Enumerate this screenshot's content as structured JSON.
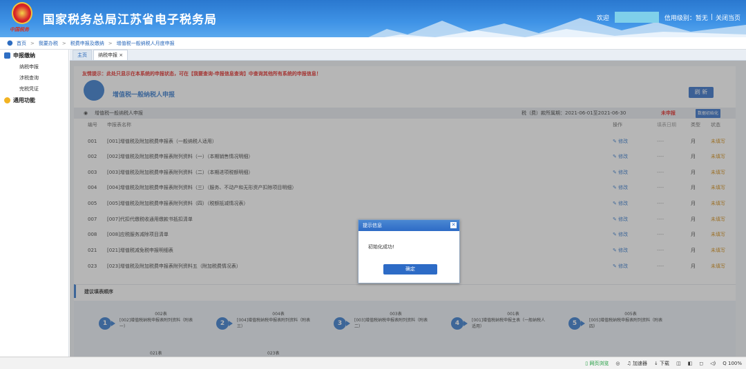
{
  "header": {
    "title": "国家税务总局江苏省电子税务局",
    "emblem_subtitle": "中国税务",
    "welcome": "欢迎",
    "credit": "信用级别：暂无",
    "divider": "|",
    "close_link": "关闭当页"
  },
  "breadcrumb": [
    "首页",
    "我要办税",
    "税费申报及缴纳",
    "增值税一般纳税人月度申报"
  ],
  "breadcrumb_sep": ">",
  "sidebar": {
    "group1": "申报缴纳",
    "items": [
      "纳税申报",
      "涉税查询",
      "完税凭证"
    ],
    "group2": "通用功能"
  },
  "tabs": [
    {
      "label": "主页"
    },
    {
      "label": "纳税申报 ×"
    }
  ],
  "content": {
    "notice": "友情提示：此处只显示在本系统的申报状态，可在【我要查询-申报信息查询】中查询其他所有系统的申报信息！",
    "biz_title": "增值税一般纳税人申报",
    "refresh": "刷 新",
    "section_radio": "◉",
    "section_title": "增值税一般纳税人申报",
    "period": "税（费）款所属期：2021-06-01至2021-06-30",
    "status": "未申报",
    "init_button": "数据初始化",
    "columns": [
      "编号",
      "申报表名称",
      "操作",
      "填表日期",
      "类型",
      "状态"
    ],
    "rows": [
      {
        "num": "001",
        "name": "[001]增值税及附加税费申报表（一般纳税人适用）",
        "op": "✎ 修改",
        "date": "----",
        "type": "月",
        "status": "未填写"
      },
      {
        "num": "002",
        "name": "[002]增值税及附加税费申报表附列资料（一）（本期销售情况明细）",
        "op": "✎ 修改",
        "date": "----",
        "type": "月",
        "status": "未填写"
      },
      {
        "num": "003",
        "name": "[003]增值税及附加税费申报表附列资料（二）（本期进项税额明细）",
        "op": "✎ 修改",
        "date": "----",
        "type": "月",
        "status": "未填写"
      },
      {
        "num": "004",
        "name": "[004]增值税及附加税费申报表附列资料（三）（服务、不动产和无形资产扣除项目明细）",
        "op": "✎ 修改",
        "date": "----",
        "type": "月",
        "status": "未填写"
      },
      {
        "num": "005",
        "name": "[005]增值税及附加税费申报表附列资料（四）（税额抵减情况表）",
        "op": "✎ 修改",
        "date": "----",
        "type": "月",
        "status": "未填写"
      },
      {
        "num": "007",
        "name": "[007]代扣代缴税收通用缴款书抵扣清单",
        "op": "✎ 修改",
        "date": "----",
        "type": "月",
        "status": "未填写"
      },
      {
        "num": "008",
        "name": "[008]应税服务减除项目清单",
        "op": "✎ 修改",
        "date": "----",
        "type": "月",
        "status": "未填写"
      },
      {
        "num": "021",
        "name": "[021]增值税减免税申报明细表",
        "op": "✎ 修改",
        "date": "----",
        "type": "月",
        "status": "未填写"
      },
      {
        "num": "023",
        "name": "[023]增值税及附加税费申报表附列资料五（附加税费情况表）",
        "op": "✎ 修改",
        "date": "----",
        "type": "月",
        "status": "未填写"
      }
    ],
    "suggest_title": "建议填表顺序",
    "steps": [
      {
        "n": "1",
        "code": "002表",
        "desc": "[002]增值税纳税申报表附列资料（附表一）"
      },
      {
        "n": "2",
        "code": "004表",
        "desc": "[004]增值税纳税申报表附列资料（附表三）"
      },
      {
        "n": "3",
        "code": "003表",
        "desc": "[003]增值税纳税申报表附列资料（附表二）"
      },
      {
        "n": "4",
        "code": "001表",
        "desc": "[001]增值税纳税申报主表（一般纳税人适用）"
      },
      {
        "n": "5",
        "code": "005表",
        "desc": "[005]增值税纳税申报表附列资料（附表四）"
      }
    ],
    "steps_row2": [
      "021表",
      "023表"
    ]
  },
  "dialog": {
    "title": "提示信息",
    "message": "初始化成功!",
    "ok": "确定",
    "close": "✕"
  },
  "statusbar": [
    "▯ 网页浏览",
    "◎",
    "♫ 加速器",
    "↓ 下载",
    "◫",
    "◧",
    "◻",
    "◁)",
    "Q 100%"
  ]
}
